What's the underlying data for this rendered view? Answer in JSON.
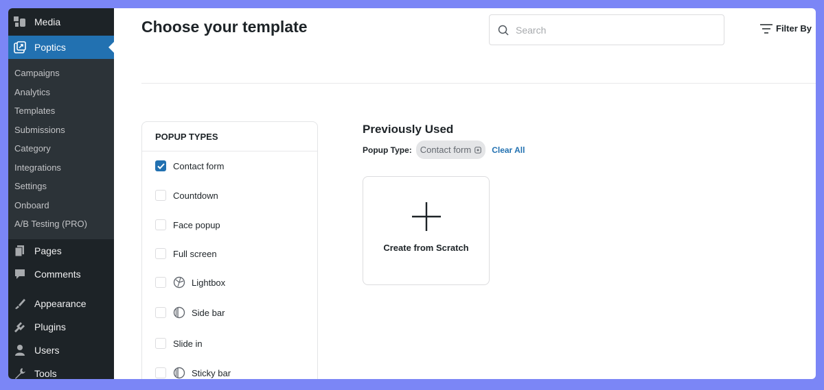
{
  "sidebar": {
    "top_item": {
      "label": "Media",
      "icon": "media-icon"
    },
    "active_item": {
      "label": "Poptics",
      "icon": "poptics-icon"
    },
    "submenu": [
      "Campaigns",
      "Analytics",
      "Templates",
      "Submissions",
      "Category",
      "Integrations",
      "Settings",
      "Onboard",
      "A/B Testing (PRO)"
    ],
    "items": [
      {
        "label": "Pages",
        "icon": "pages-icon"
      },
      {
        "label": "Comments",
        "icon": "comments-icon"
      },
      {
        "label": "Appearance",
        "icon": "appearance-icon"
      },
      {
        "label": "Plugins",
        "icon": "plugins-icon"
      },
      {
        "label": "Users",
        "icon": "users-icon"
      },
      {
        "label": "Tools",
        "icon": "tools-icon"
      }
    ]
  },
  "header": {
    "title": "Choose your template",
    "search_placeholder": "Search",
    "search_value": "",
    "filter_label": "Filter By"
  },
  "popup_types": {
    "heading": "POPUP TYPES",
    "items": [
      {
        "label": "Contact form",
        "checked": true,
        "icon": null
      },
      {
        "label": "Countdown",
        "checked": false,
        "icon": null
      },
      {
        "label": "Face popup",
        "checked": false,
        "icon": null
      },
      {
        "label": "Full screen",
        "checked": false,
        "icon": null
      },
      {
        "label": "Lightbox",
        "checked": false,
        "icon": "lightbox-icon"
      },
      {
        "label": "Side bar",
        "checked": false,
        "icon": "sidebar-pro-icon"
      },
      {
        "label": "Slide in",
        "checked": false,
        "icon": null
      },
      {
        "label": "Sticky bar",
        "checked": false,
        "icon": "stickybar-pro-icon"
      }
    ]
  },
  "previously_used": {
    "title": "Previously Used",
    "filter_label": "Popup Type:",
    "chip_label": "Contact form",
    "clear_label": "Clear All",
    "card_label": "Create from Scratch"
  },
  "colors": {
    "accent": "#2271b1",
    "sidebar_bg": "#1d2327",
    "submenu_bg": "#2c3338",
    "page_bg": "#7b86f6"
  }
}
